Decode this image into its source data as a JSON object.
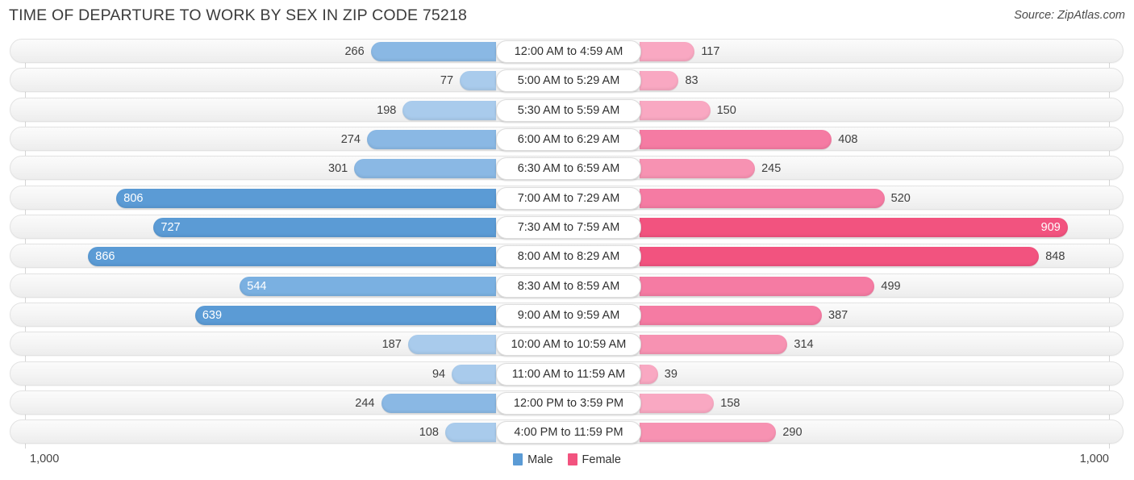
{
  "header": {
    "title": "TIME OF DEPARTURE TO WORK BY SEX IN ZIP CODE 75218",
    "source": "Source: ZipAtlas.com"
  },
  "footer": {
    "axis_left": "1,000",
    "axis_right": "1,000",
    "legend": [
      {
        "label": "Male",
        "color": "#5b9bd5"
      },
      {
        "label": "Female",
        "color": "#f2537f"
      }
    ]
  },
  "chart_data": {
    "type": "bar",
    "subtype": "diverging-bidirectional",
    "title": "TIME OF DEPARTURE TO WORK BY SEX IN ZIP CODE 75218",
    "xlabel": "",
    "ylabel": "",
    "xlim": [
      1000,
      1000
    ],
    "axis_max": 1000,
    "grid": false,
    "legend_position": "bottom-center",
    "categories": [
      "12:00 AM to 4:59 AM",
      "5:00 AM to 5:29 AM",
      "5:30 AM to 5:59 AM",
      "6:00 AM to 6:29 AM",
      "6:30 AM to 6:59 AM",
      "7:00 AM to 7:29 AM",
      "7:30 AM to 7:59 AM",
      "8:00 AM to 8:29 AM",
      "8:30 AM to 8:59 AM",
      "9:00 AM to 9:59 AM",
      "10:00 AM to 10:59 AM",
      "11:00 AM to 11:59 AM",
      "12:00 PM to 3:59 PM",
      "4:00 PM to 11:59 PM"
    ],
    "series": [
      {
        "name": "Male",
        "direction": "left",
        "color": "#5b9bd5",
        "values": [
          266,
          77,
          198,
          274,
          301,
          806,
          727,
          866,
          544,
          639,
          187,
          94,
          244,
          108
        ]
      },
      {
        "name": "Female",
        "direction": "right",
        "color": "#f2537f",
        "values": [
          117,
          83,
          150,
          408,
          245,
          520,
          909,
          848,
          499,
          387,
          314,
          39,
          158,
          290
        ]
      }
    ]
  }
}
